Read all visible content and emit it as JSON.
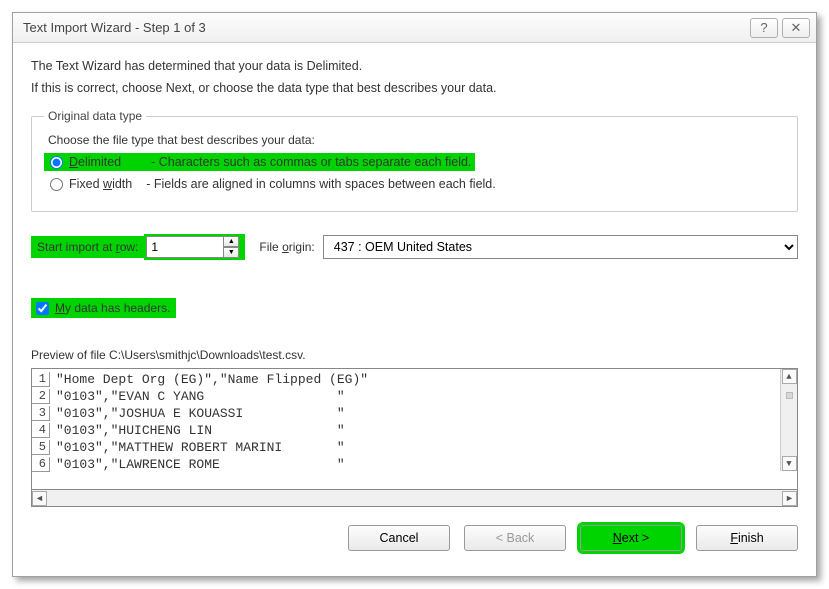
{
  "title": "Text Import Wizard - Step 1 of 3",
  "intro1": "The Text Wizard has determined that your data is Delimited.",
  "intro2": "If this is correct, choose Next, or choose the data type that best describes your data.",
  "groupbox": {
    "legend": "Original data type",
    "prompt": "Choose the file type that best describes your data:",
    "delimited_label": "Delimited",
    "delimited_desc": "- Characters such as commas or tabs separate each field.",
    "fixed_label": "Fixed width",
    "fixed_desc": "- Fields are aligned in columns with spaces between each field."
  },
  "start_row": {
    "label": "Start import at row:",
    "value": "1"
  },
  "origin": {
    "label": "File origin:",
    "value": "437 : OEM United States"
  },
  "headers": {
    "label": "My data has headers."
  },
  "preview": {
    "label": "Preview of file C:\\Users\\smithjc\\Downloads\\test.csv.",
    "rows": [
      "\"Home Dept Org (EG)\",\"Name Flipped (EG)\"",
      "\"0103\",\"EVAN C YANG                 \"",
      "\"0103\",\"JOSHUA E KOUASSI            \"",
      "\"0103\",\"HUICHENG LIN                \"",
      "\"0103\",\"MATTHEW ROBERT MARINI       \"",
      "\"0103\",\"LAWRENCE ROME               \""
    ]
  },
  "buttons": {
    "cancel": "Cancel",
    "back": "< Back",
    "next": "Next >",
    "finish": "Finish"
  }
}
